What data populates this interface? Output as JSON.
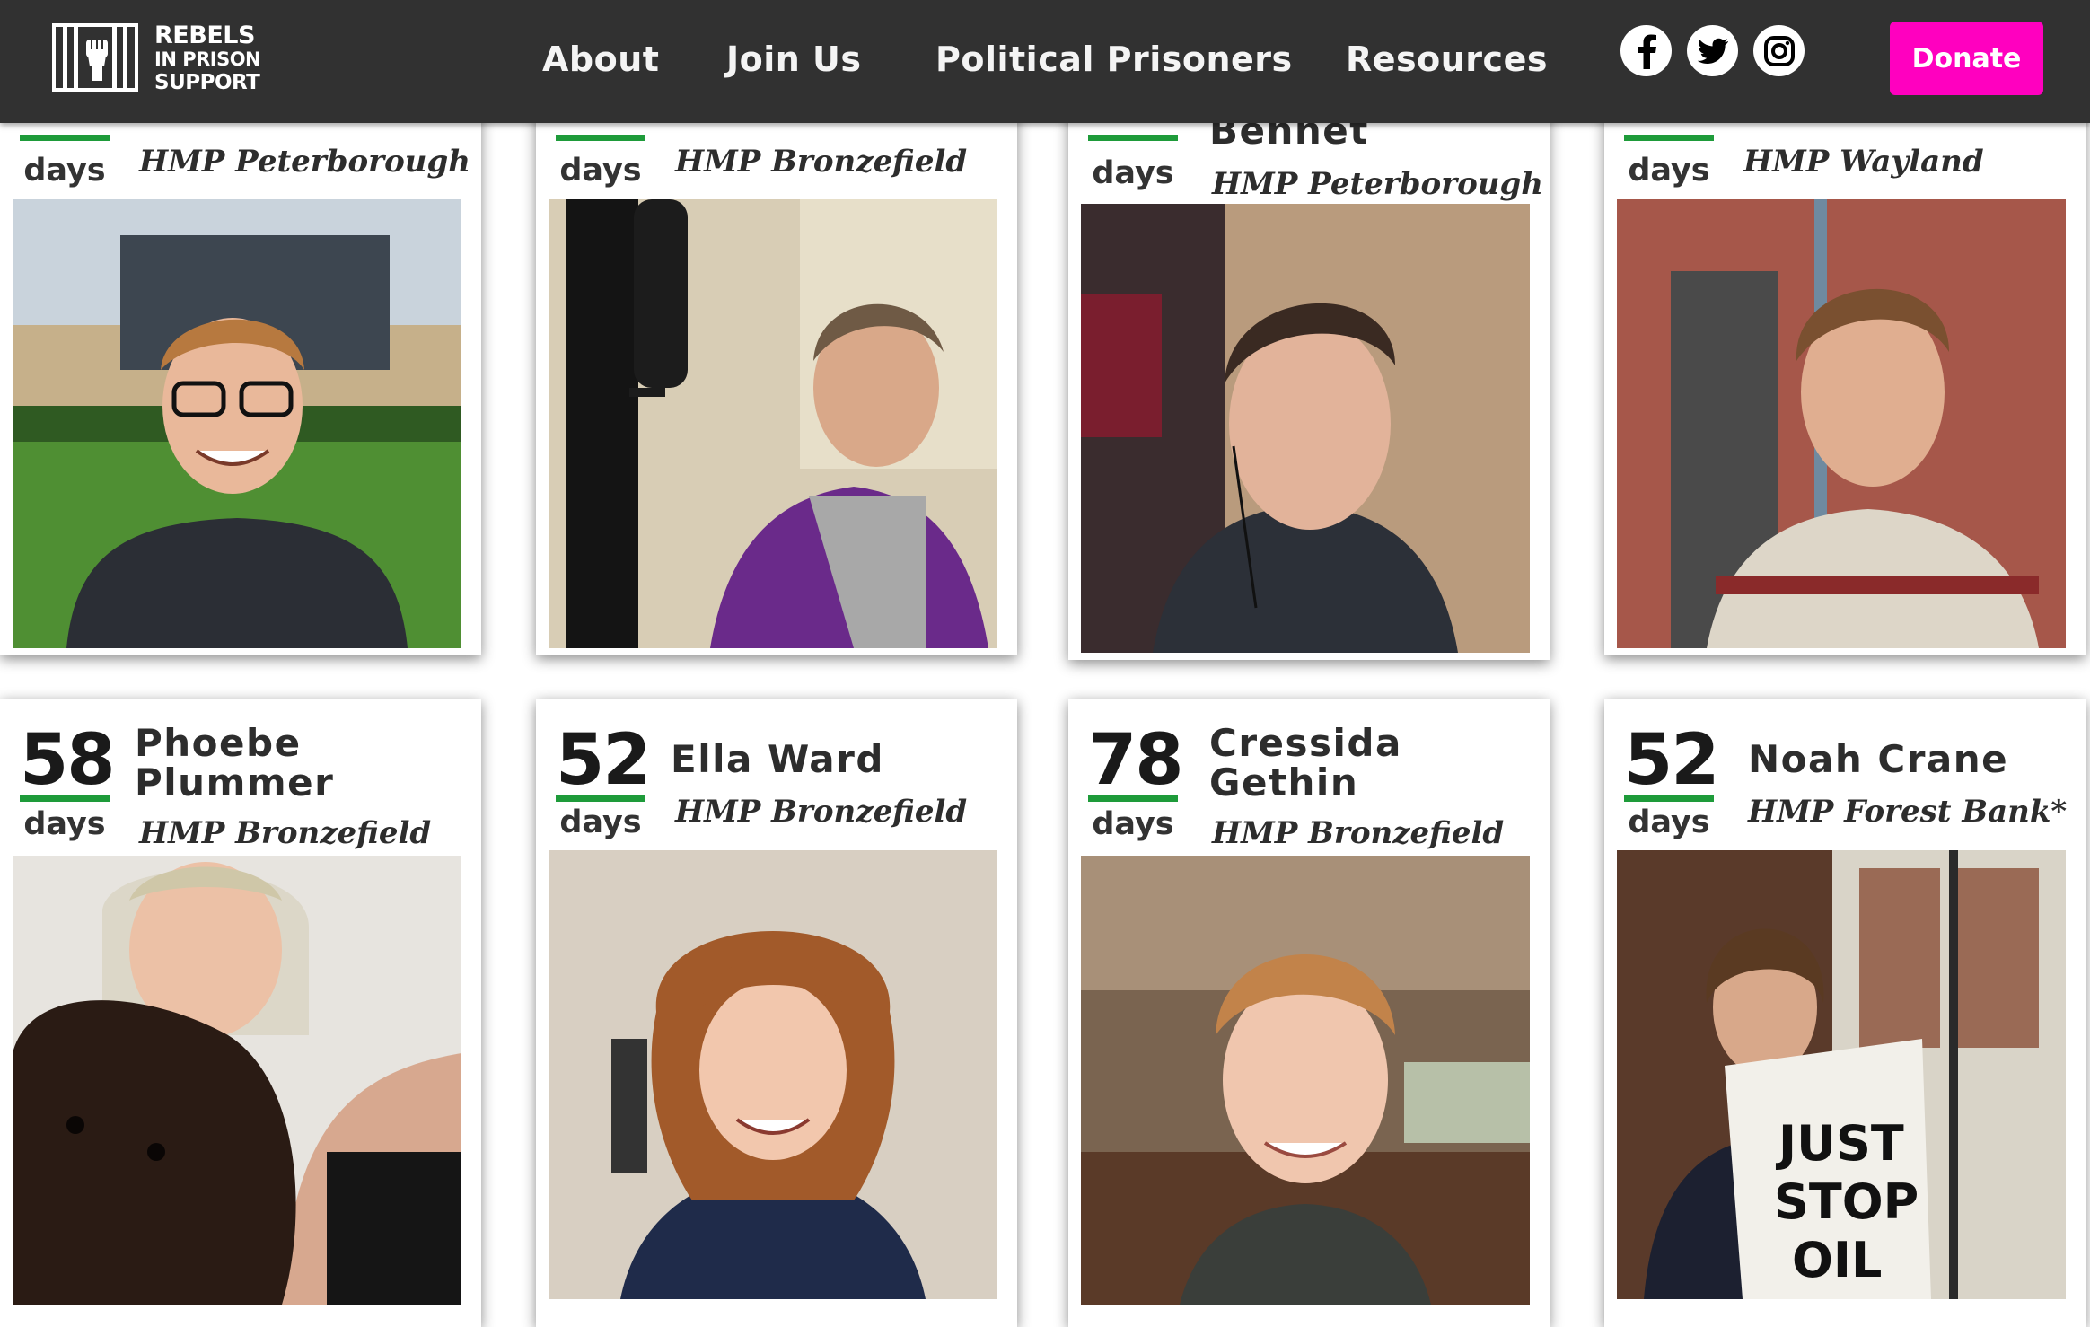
{
  "nav": {
    "logo": {
      "line1": "REBELS",
      "line2": "IN PRISON",
      "line3": "SUPPORT",
      "icon": "raised-fist-icon"
    },
    "links": [
      "About",
      "Join Us",
      "Political Prisoners",
      "Resources"
    ],
    "social": [
      "facebook-icon",
      "twitter-icon",
      "instagram-icon"
    ],
    "donate": "Donate"
  },
  "colors": {
    "nav_bg": "#313131",
    "accent_green": "#1e9b3a",
    "donate_pink": "#ff00bf"
  },
  "prisoners_top": [
    {
      "days": "",
      "days_label": "days",
      "name": "",
      "prison": "HMP Peterborough"
    },
    {
      "days": "",
      "days_label": "days",
      "name": "",
      "prison": "HMP Bronzefield"
    },
    {
      "days": "",
      "days_label": "days",
      "name": "Bennet",
      "prison": "HMP Peterborough"
    },
    {
      "days": "",
      "days_label": "days",
      "name": "",
      "prison": "HMP Wayland"
    }
  ],
  "prisoners_bottom": [
    {
      "days": "58",
      "days_label": "days",
      "name_line1": "Phoebe",
      "name_line2": "Plummer",
      "prison": "HMP Bronzefield"
    },
    {
      "days": "52",
      "days_label": "days",
      "name_line1": "Ella Ward",
      "name_line2": "",
      "prison": "HMP Bronzefield"
    },
    {
      "days": "78",
      "days_label": "days",
      "name_line1": "Cressida",
      "name_line2": "Gethin",
      "prison": "HMP Bronzefield"
    },
    {
      "days": "52",
      "days_label": "days",
      "name_line1": "Noah Crane",
      "name_line2": "",
      "prison": "HMP Forest Bank*"
    }
  ],
  "banner_text": "JUST STOP OIL"
}
